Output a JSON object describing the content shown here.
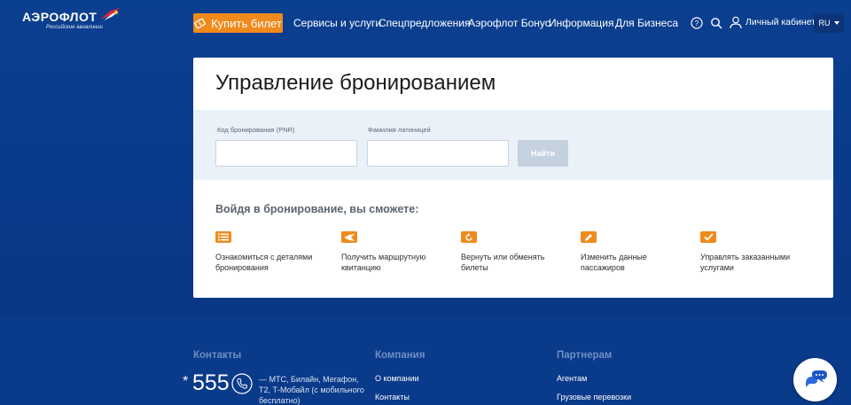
{
  "header": {
    "logo_text": "АЭРОФЛОТ",
    "logo_sub": "Российские авиалинии",
    "buy_ticket": "Купить билет",
    "nav": [
      "Сервисы и услуги",
      "Спецпредложения",
      "Аэрофлот Бонус",
      "Информация",
      "Для Бизнеса"
    ],
    "cabinet": "Личный кабинет",
    "lang": "RU"
  },
  "card": {
    "title": "Управление бронированием",
    "form": {
      "pnr_label": "Код бронирования (PNR)",
      "pnr_value": "",
      "surname_label": "Фамилия латиницей",
      "surname_value": "",
      "find_button": "Найти"
    },
    "benefits_title": "Войдя в бронирование, вы сможете:",
    "benefits": [
      {
        "icon": "list-icon",
        "text": "Ознакомиться с деталями бронирования"
      },
      {
        "icon": "ticket-icon",
        "text": "Получить маршрутную квитанцию"
      },
      {
        "icon": "refresh-icon",
        "text": "Вернуть или обменять билеты"
      },
      {
        "icon": "edit-icon",
        "text": "Изменить данные пассажиров"
      },
      {
        "icon": "check-icon",
        "text": "Управлять заказанными услугами"
      }
    ]
  },
  "footer": {
    "contacts_title": "Контакты",
    "company_title": "Компания",
    "partners_title": "Партнерам",
    "phone_prefix": "*",
    "phone": "555",
    "phone_note": "— МТС, Билайн, Мегафон, Т2, Т-Мобайл (с мобильного бесплатно)",
    "company_links": [
      "О компании",
      "Контакты"
    ],
    "partner_links": [
      "Агентам",
      "Грузовые перевозки"
    ]
  },
  "colors": {
    "brand_blue": "#0a3a8a",
    "accent_orange": "#f08a1c",
    "form_band": "#eaf1f8"
  }
}
